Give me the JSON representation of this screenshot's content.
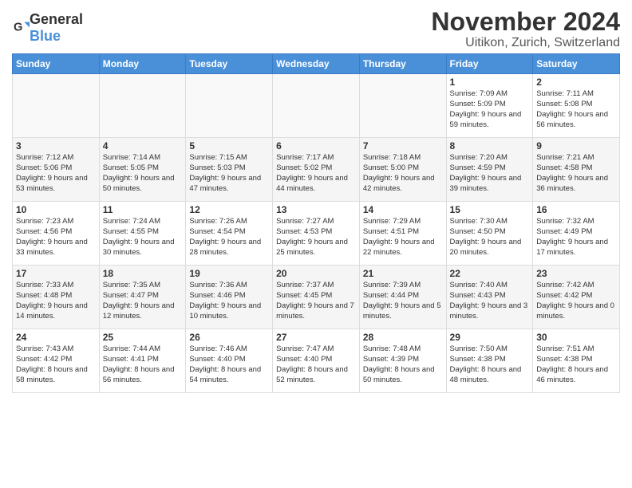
{
  "header": {
    "logo_general": "General",
    "logo_blue": "Blue",
    "title": "November 2024",
    "subtitle": "Uitikon, Zurich, Switzerland"
  },
  "columns": [
    "Sunday",
    "Monday",
    "Tuesday",
    "Wednesday",
    "Thursday",
    "Friday",
    "Saturday"
  ],
  "weeks": [
    [
      {
        "day": "",
        "info": ""
      },
      {
        "day": "",
        "info": ""
      },
      {
        "day": "",
        "info": ""
      },
      {
        "day": "",
        "info": ""
      },
      {
        "day": "",
        "info": ""
      },
      {
        "day": "1",
        "info": "Sunrise: 7:09 AM\nSunset: 5:09 PM\nDaylight: 9 hours and 59 minutes."
      },
      {
        "day": "2",
        "info": "Sunrise: 7:11 AM\nSunset: 5:08 PM\nDaylight: 9 hours and 56 minutes."
      }
    ],
    [
      {
        "day": "3",
        "info": "Sunrise: 7:12 AM\nSunset: 5:06 PM\nDaylight: 9 hours and 53 minutes."
      },
      {
        "day": "4",
        "info": "Sunrise: 7:14 AM\nSunset: 5:05 PM\nDaylight: 9 hours and 50 minutes."
      },
      {
        "day": "5",
        "info": "Sunrise: 7:15 AM\nSunset: 5:03 PM\nDaylight: 9 hours and 47 minutes."
      },
      {
        "day": "6",
        "info": "Sunrise: 7:17 AM\nSunset: 5:02 PM\nDaylight: 9 hours and 44 minutes."
      },
      {
        "day": "7",
        "info": "Sunrise: 7:18 AM\nSunset: 5:00 PM\nDaylight: 9 hours and 42 minutes."
      },
      {
        "day": "8",
        "info": "Sunrise: 7:20 AM\nSunset: 4:59 PM\nDaylight: 9 hours and 39 minutes."
      },
      {
        "day": "9",
        "info": "Sunrise: 7:21 AM\nSunset: 4:58 PM\nDaylight: 9 hours and 36 minutes."
      }
    ],
    [
      {
        "day": "10",
        "info": "Sunrise: 7:23 AM\nSunset: 4:56 PM\nDaylight: 9 hours and 33 minutes."
      },
      {
        "day": "11",
        "info": "Sunrise: 7:24 AM\nSunset: 4:55 PM\nDaylight: 9 hours and 30 minutes."
      },
      {
        "day": "12",
        "info": "Sunrise: 7:26 AM\nSunset: 4:54 PM\nDaylight: 9 hours and 28 minutes."
      },
      {
        "day": "13",
        "info": "Sunrise: 7:27 AM\nSunset: 4:53 PM\nDaylight: 9 hours and 25 minutes."
      },
      {
        "day": "14",
        "info": "Sunrise: 7:29 AM\nSunset: 4:51 PM\nDaylight: 9 hours and 22 minutes."
      },
      {
        "day": "15",
        "info": "Sunrise: 7:30 AM\nSunset: 4:50 PM\nDaylight: 9 hours and 20 minutes."
      },
      {
        "day": "16",
        "info": "Sunrise: 7:32 AM\nSunset: 4:49 PM\nDaylight: 9 hours and 17 minutes."
      }
    ],
    [
      {
        "day": "17",
        "info": "Sunrise: 7:33 AM\nSunset: 4:48 PM\nDaylight: 9 hours and 14 minutes."
      },
      {
        "day": "18",
        "info": "Sunrise: 7:35 AM\nSunset: 4:47 PM\nDaylight: 9 hours and 12 minutes."
      },
      {
        "day": "19",
        "info": "Sunrise: 7:36 AM\nSunset: 4:46 PM\nDaylight: 9 hours and 10 minutes."
      },
      {
        "day": "20",
        "info": "Sunrise: 7:37 AM\nSunset: 4:45 PM\nDaylight: 9 hours and 7 minutes."
      },
      {
        "day": "21",
        "info": "Sunrise: 7:39 AM\nSunset: 4:44 PM\nDaylight: 9 hours and 5 minutes."
      },
      {
        "day": "22",
        "info": "Sunrise: 7:40 AM\nSunset: 4:43 PM\nDaylight: 9 hours and 3 minutes."
      },
      {
        "day": "23",
        "info": "Sunrise: 7:42 AM\nSunset: 4:42 PM\nDaylight: 9 hours and 0 minutes."
      }
    ],
    [
      {
        "day": "24",
        "info": "Sunrise: 7:43 AM\nSunset: 4:42 PM\nDaylight: 8 hours and 58 minutes."
      },
      {
        "day": "25",
        "info": "Sunrise: 7:44 AM\nSunset: 4:41 PM\nDaylight: 8 hours and 56 minutes."
      },
      {
        "day": "26",
        "info": "Sunrise: 7:46 AM\nSunset: 4:40 PM\nDaylight: 8 hours and 54 minutes."
      },
      {
        "day": "27",
        "info": "Sunrise: 7:47 AM\nSunset: 4:40 PM\nDaylight: 8 hours and 52 minutes."
      },
      {
        "day": "28",
        "info": "Sunrise: 7:48 AM\nSunset: 4:39 PM\nDaylight: 8 hours and 50 minutes."
      },
      {
        "day": "29",
        "info": "Sunrise: 7:50 AM\nSunset: 4:38 PM\nDaylight: 8 hours and 48 minutes."
      },
      {
        "day": "30",
        "info": "Sunrise: 7:51 AM\nSunset: 4:38 PM\nDaylight: 8 hours and 46 minutes."
      }
    ]
  ]
}
